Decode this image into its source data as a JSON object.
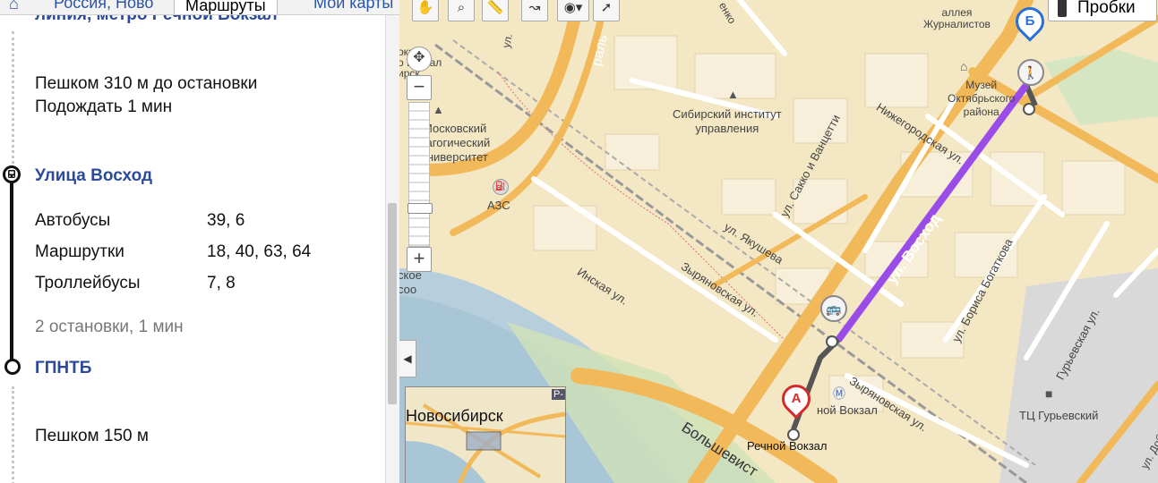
{
  "tabs": {
    "items": [
      {
        "label": "Россия, Ново"
      },
      {
        "label": "Маршруты"
      },
      {
        "label": "Мои карты"
      }
    ]
  },
  "route": {
    "header_cut": "линия, метро Речной Вокзал",
    "walk1": "Пешком 310 м до остановки",
    "wait": "Подождать 1 мин",
    "stop1": "Улица Восход",
    "transit": [
      {
        "type": "Автобусы",
        "routes": "39, 6"
      },
      {
        "type": "Маршрутки",
        "routes": "18, 40, 63, 64"
      },
      {
        "type": "Троллейбусы",
        "routes": "7, 8"
      }
    ],
    "stops_summary": "2 остановки, 1 мин",
    "stop2": "ГПНТБ",
    "walk2": "Пешком 150 м"
  },
  "map": {
    "traffic_label": "Пробки",
    "minimap_label": "Новосибирск",
    "minimap_badge": "Р-",
    "marker_a": "А",
    "marker_b": "Б",
    "labels": {
      "alley": "аллея\nЖурналистов",
      "museum": "Музей\nОктябрьского\nрайона",
      "institute": "Сибирский институт\nуправления",
      "university": "Московский\nдагогический\nуниверситет",
      "vokzal_top": "окзал\nо Вокзал\nирск",
      "azs": "АЗС",
      "sakko": "ул. Сакко и Ванцетти",
      "nizhegorodskaya": "Нижегородская ул.",
      "yakusheva": "ул. Якушева",
      "voshod": "ул. Восход",
      "inskaya": "Инская ул.",
      "zyryanovskaya1": "Зыряновская ул.",
      "zyryanovskaya2": "Зыряновская ул.",
      "bogatkova": "ул. Бориса Богаткова",
      "guryevskaya": "Гурьевская ул.",
      "tc": "ТЦ Гурьевский",
      "rechnoy_station": "ной Вокзал",
      "rechnoy_stop": "Речной Вокзал",
      "bolshevistskaya": "Большевист",
      "rskoe": "ское\nсоо",
      "ural": "раль",
      "enko": "енко",
      "dob": "ул. Доб",
      "ul": "ул."
    }
  }
}
